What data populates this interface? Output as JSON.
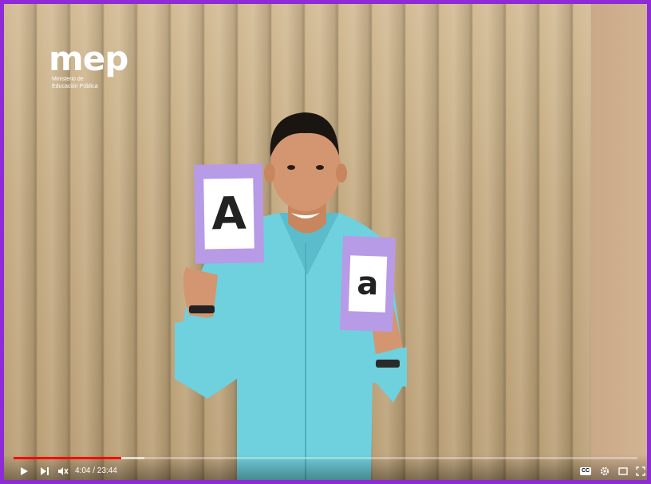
{
  "logo": {
    "word": "mep",
    "subtitle_line1": "Ministerio de",
    "subtitle_line2": "Educación Pública"
  },
  "cards": {
    "uppercase": "A",
    "lowercase": "a"
  },
  "player": {
    "current_time": "4:04",
    "duration": "23:44",
    "time_display": "4:04 / 23:44",
    "progress_played": 0.172,
    "progress_loaded": 0.21,
    "cc_label": "CC",
    "icons": [
      "play-icon",
      "next-icon",
      "mute-icon",
      "cc-icon",
      "settings-icon",
      "theater-icon",
      "fullscreen-icon"
    ]
  },
  "colors": {
    "frame_border": "#8e2bd6",
    "card_border": "#b79be6",
    "progress_played": "#ff0000",
    "shirt": "#6fd0de"
  }
}
